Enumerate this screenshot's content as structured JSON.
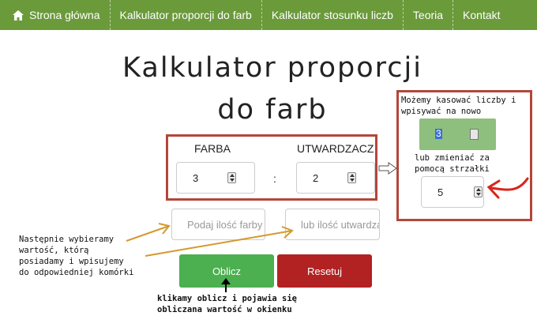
{
  "nav": {
    "items": [
      {
        "label": "Strona główna",
        "icon": "home-icon"
      },
      {
        "label": "Kalkulator proporcji do farb"
      },
      {
        "label": "Kalkulator stosunku liczb"
      },
      {
        "label": "Teoria"
      },
      {
        "label": "Kontakt"
      }
    ],
    "color": "#6b9a3a"
  },
  "page": {
    "title_line1": "Kalkulator proporcji",
    "title_line2": "do farb"
  },
  "form": {
    "farba_label": "FARBA",
    "utwardzacz_label": "UTWARDZACZ",
    "farba_value": "3",
    "utwardzacz_value": "2",
    "separator": ":",
    "farba_amount_placeholder": "Podaj ilość farby",
    "utwardzacz_amount_placeholder": "lub ilość utwardzacza",
    "calc_button": "Oblicz",
    "reset_button": "Resetuj",
    "calc_color": "#4caf50",
    "reset_color": "#b22222"
  },
  "annotations": {
    "side_top": "Możemy kasować liczby i\nwpisywać na nowo",
    "side_selected_value": "3",
    "side_middle": "lub zmieniać za\npomocą strzałki",
    "side_spinner_value": "5",
    "left_note": "Następnie wybieramy\nwartość, którą\nposiadamy i wpisujemy\ndo odpowiedniej komórki",
    "bottom_note": "klikamy oblicz i pojawia się\nobliczana wartość w okienku",
    "box_color": "#b3473a"
  }
}
